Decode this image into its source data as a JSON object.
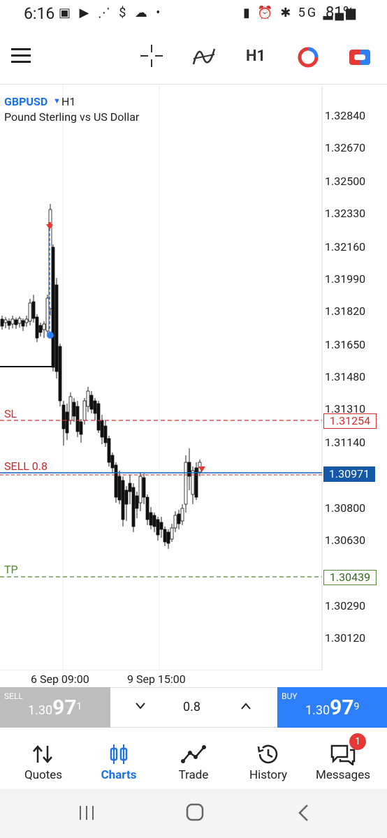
{
  "status": {
    "time": "6:16",
    "network": "5G",
    "battery": "81%"
  },
  "toolbar": {
    "timeframe": "H1"
  },
  "chart": {
    "symbol": "GBPUSD",
    "timeframe": "H1",
    "description": "Pound Sterling vs US Dollar",
    "price_labels": [
      "1.32840",
      "1.32670",
      "1.32500",
      "1.32330",
      "1.32160",
      "1.31990",
      "1.31820",
      "1.31650",
      "1.31480",
      "1.31310",
      "1.31140",
      "1.30800",
      "1.30630",
      "1.30290",
      "1.30120"
    ],
    "date_labels": [
      "6 Sep 09:00",
      "9 Sep 15:00"
    ],
    "sl_label": "SL",
    "sl_price": "1.31254",
    "sell_label": "SELL 0.8",
    "current_price": "1.30971",
    "tp_label": "TP",
    "tp_price": "1.30439"
  },
  "order": {
    "sell_caption": "SELL",
    "sell_prefix": "1.30",
    "sell_big": "97",
    "sell_sup": "1",
    "volume": "0.8",
    "buy_caption": "BUY",
    "buy_prefix": "1.30",
    "buy_big": "97",
    "buy_sup": "9"
  },
  "nav": {
    "quotes": "Quotes",
    "charts": "Charts",
    "trade": "Trade",
    "history": "History",
    "messages": "Messages",
    "messages_badge": "1"
  },
  "colors": {
    "accent": "#1a73e8",
    "sl": "#d32f2f",
    "tp": "#558b2f",
    "buy": "#2d7ff9",
    "sell": "#bdbdbd"
  }
}
